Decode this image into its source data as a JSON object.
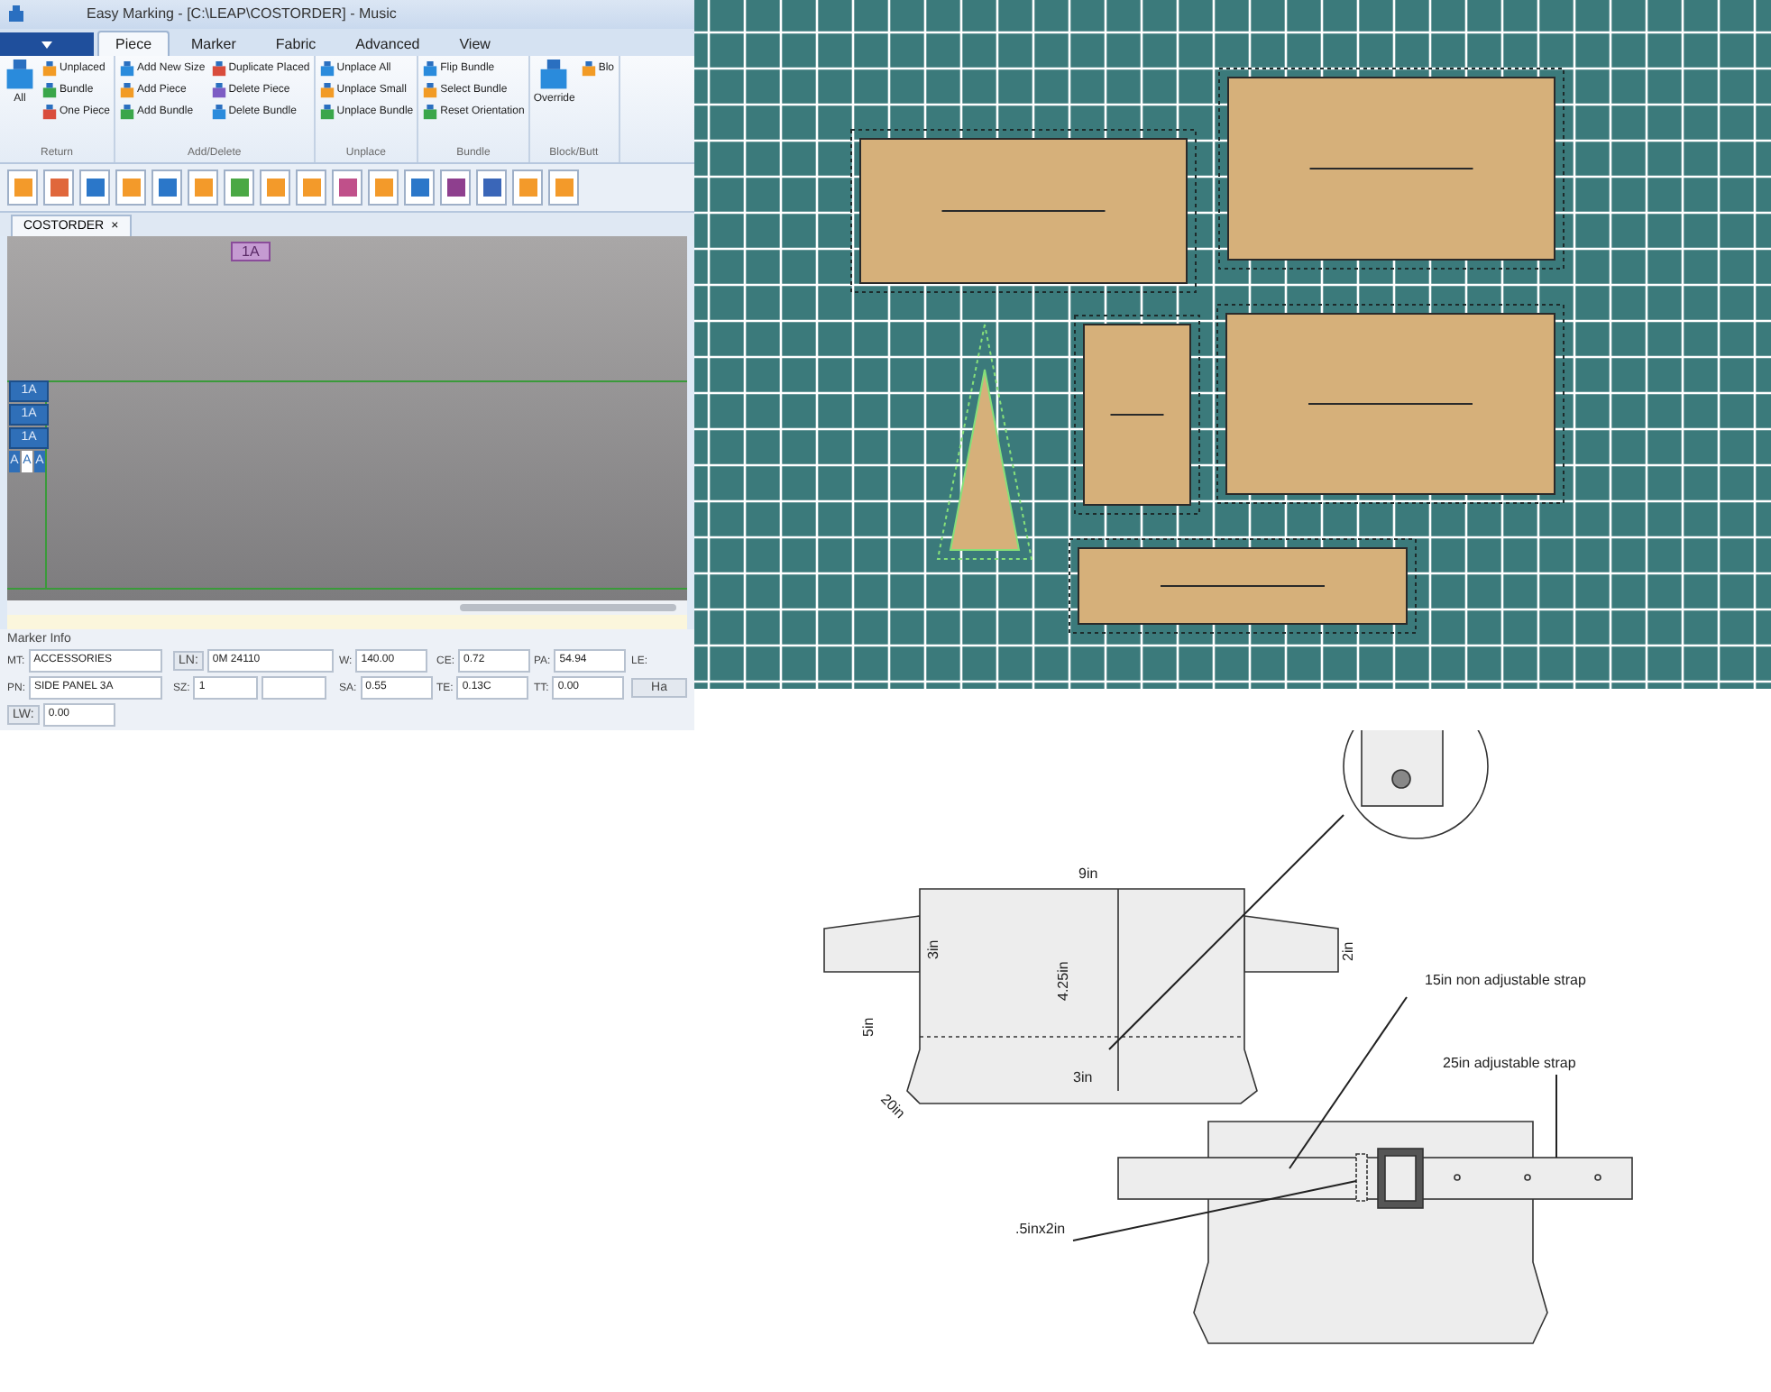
{
  "app": {
    "title": "Easy Marking - [C:\\LEAP\\COSTORDER] - Music",
    "menu_tabs": [
      {
        "label": "Piece",
        "selected": true
      },
      {
        "label": "Marker",
        "selected": false
      },
      {
        "label": "Fabric",
        "selected": false
      },
      {
        "label": "Advanced",
        "selected": false
      },
      {
        "label": "View",
        "selected": false
      }
    ],
    "ribbon_groups": [
      {
        "label": "Return",
        "items": [
          {
            "label": "All",
            "kind": "large"
          },
          {
            "label": "Unplaced",
            "kind": "small"
          },
          {
            "label": "Bundle",
            "kind": "small"
          },
          {
            "label": "One Piece",
            "kind": "small"
          }
        ]
      },
      {
        "label": "Add/Delete",
        "items": [
          {
            "label": "Add New Size",
            "kind": "small"
          },
          {
            "label": "Add Piece",
            "kind": "small"
          },
          {
            "label": "Add Bundle",
            "kind": "small"
          },
          {
            "label": "Duplicate Placed",
            "kind": "small"
          },
          {
            "label": "Delete Piece",
            "kind": "small"
          },
          {
            "label": "Delete Bundle",
            "kind": "small"
          }
        ]
      },
      {
        "label": "Unplace",
        "items": [
          {
            "label": "Unplace All",
            "kind": "small"
          },
          {
            "label": "Unplace Small",
            "kind": "small"
          },
          {
            "label": "Unplace Bundle",
            "kind": "small"
          }
        ]
      },
      {
        "label": "Bundle",
        "items": [
          {
            "label": "Flip Bundle",
            "kind": "small"
          },
          {
            "label": "Select Bundle",
            "kind": "small"
          },
          {
            "label": "Reset Orientation",
            "kind": "small"
          }
        ]
      },
      {
        "label": "Block/Butt",
        "items": [
          {
            "label": "Override",
            "kind": "large"
          },
          {
            "label": "Blo",
            "kind": "small"
          }
        ]
      }
    ],
    "document_tab": {
      "label": "COSTORDER",
      "close": "×"
    },
    "canvas_labels": {
      "top": "1A",
      "left_stack": [
        "1A",
        "1A",
        "1A"
      ],
      "bottom_row": [
        {
          "label": "A",
          "selected": false
        },
        {
          "label": "A",
          "selected": true
        },
        {
          "label": "A",
          "selected": false
        }
      ]
    },
    "marker_info": {
      "title": "Marker Info",
      "rows": [
        [
          {
            "kind": "field",
            "label": "MT:",
            "value": "ACCESSORIES"
          },
          {
            "kind": "button_field",
            "label": "LN:",
            "value": "0M 24110"
          },
          {
            "kind": "field",
            "label": "W:",
            "value": "140.00"
          },
          {
            "kind": "field",
            "label": "CE:",
            "value": "0.72"
          },
          {
            "kind": "field",
            "label": "PA:",
            "value": "54.94"
          },
          {
            "kind": "label",
            "label": "LE:"
          }
        ],
        [
          {
            "kind": "field",
            "label": "PN:",
            "value": "SIDE PANEL 3A"
          },
          {
            "kind": "field",
            "label": "SZ:",
            "value": "1",
            "second_box": true
          },
          {
            "kind": "field",
            "label": "SA:",
            "value": "0.55"
          },
          {
            "kind": "field",
            "label": "TE:",
            "value": "0.13C"
          },
          {
            "kind": "field",
            "label": "TT:",
            "value": "0.00"
          },
          {
            "kind": "button",
            "label": "Ha"
          }
        ],
        [
          {
            "kind": "button_field",
            "label": "LW:",
            "value": "0.00"
          }
        ]
      ]
    }
  },
  "drawing": {
    "labels": [
      "9in",
      "3in",
      "4.25in",
      "5in",
      "2in",
      "20in",
      "3in",
      "15in non adjustable strap",
      "25in adjustable strap",
      ".5inx2in"
    ]
  }
}
